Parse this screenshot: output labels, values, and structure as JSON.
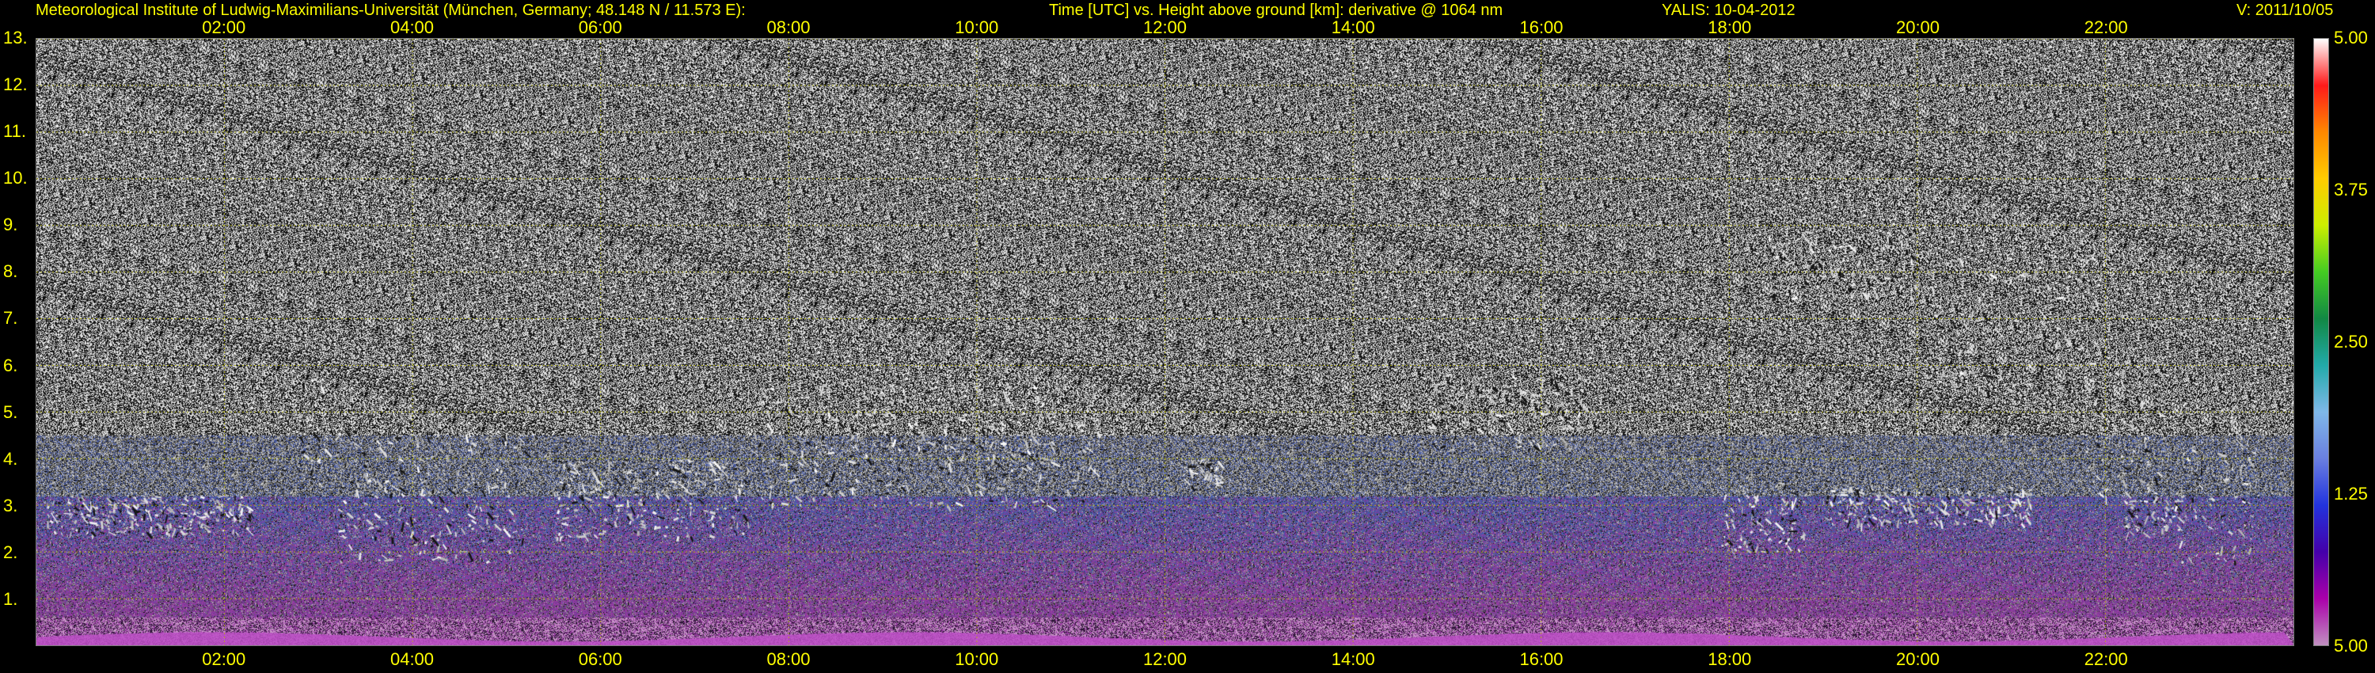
{
  "header": {
    "institute": "Meteorological Institute of Ludwig-Maximilians-Universität (München, Germany; 48.148 N / 11.573 E):",
    "description": "Time [UTC] vs. Height above ground [km]: derivative @ 1064 nm",
    "instrument_date": "YALIS: 10-04-2012",
    "version": "V: 2011/10/05"
  },
  "chart_data": {
    "type": "heatmap",
    "title": "Time [UTC] vs. Height above ground [km]: derivative @ 1064 nm",
    "xlabel": "",
    "ylabel": "",
    "x_ticks": [
      "02:00",
      "04:00",
      "06:00",
      "08:00",
      "10:00",
      "12:00",
      "14:00",
      "16:00",
      "18:00",
      "20:00",
      "22:00"
    ],
    "x_tick_hours": [
      2,
      4,
      6,
      8,
      10,
      12,
      14,
      16,
      18,
      20,
      22
    ],
    "xlim_hours": [
      0,
      24
    ],
    "y_ticks": [
      "1.",
      "2.",
      "3.",
      "4.",
      "5.",
      "6.",
      "7.",
      "8.",
      "9.",
      "10.",
      "11.",
      "12.",
      "13."
    ],
    "y_tick_values": [
      1,
      2,
      3,
      4,
      5,
      6,
      7,
      8,
      9,
      10,
      11,
      12,
      13
    ],
    "ylim": [
      0,
      13
    ],
    "grid": true,
    "colorbar": {
      "labels": [
        "5.00",
        "3.75",
        "2.50",
        "1.25",
        "5.00"
      ],
      "label_values": [
        5.0,
        3.75,
        2.5,
        1.25,
        0
      ],
      "colors": [
        "#ffffff",
        "#ff1a1a",
        "#ff8800",
        "#ffcc00",
        "#ccee00",
        "#44cc22",
        "#118844",
        "#22aaaa",
        "#7fb8e8",
        "#6a7fe0",
        "#2233dd",
        "#4400aa",
        "#aa00aa",
        "#c090c0"
      ]
    },
    "cloud_layers": [
      {
        "start": 0.1,
        "end": 2.3,
        "base": 2.4,
        "top": 3.2
      },
      {
        "start": 2.8,
        "end": 3.1,
        "base": 3.2,
        "top": 6.0
      },
      {
        "start": 3.2,
        "end": 5.2,
        "base": 1.8,
        "top": 4.6
      },
      {
        "start": 5.5,
        "end": 7.6,
        "base": 2.3,
        "top": 4.0
      },
      {
        "start": 7.6,
        "end": 11.3,
        "base": 3.0,
        "top": 5.6
      },
      {
        "start": 12.2,
        "end": 12.6,
        "base": 3.4,
        "top": 4.0
      },
      {
        "start": 14.8,
        "end": 16.5,
        "base": 4.2,
        "top": 5.8
      },
      {
        "start": 17.9,
        "end": 18.8,
        "base": 2.0,
        "top": 3.5
      },
      {
        "start": 19.0,
        "end": 21.2,
        "base": 2.6,
        "top": 3.4
      },
      {
        "start": 18.4,
        "end": 20.0,
        "base": 7.4,
        "top": 8.9
      },
      {
        "start": 20.1,
        "end": 21.9,
        "base": 5.4,
        "top": 8.4
      },
      {
        "start": 21.8,
        "end": 22.6,
        "base": 3.2,
        "top": 6.2
      },
      {
        "start": 22.2,
        "end": 22.8,
        "base": 2.4,
        "top": 3.2
      },
      {
        "start": 22.8,
        "end": 23.6,
        "base": 1.8,
        "top": 5.2
      }
    ]
  }
}
